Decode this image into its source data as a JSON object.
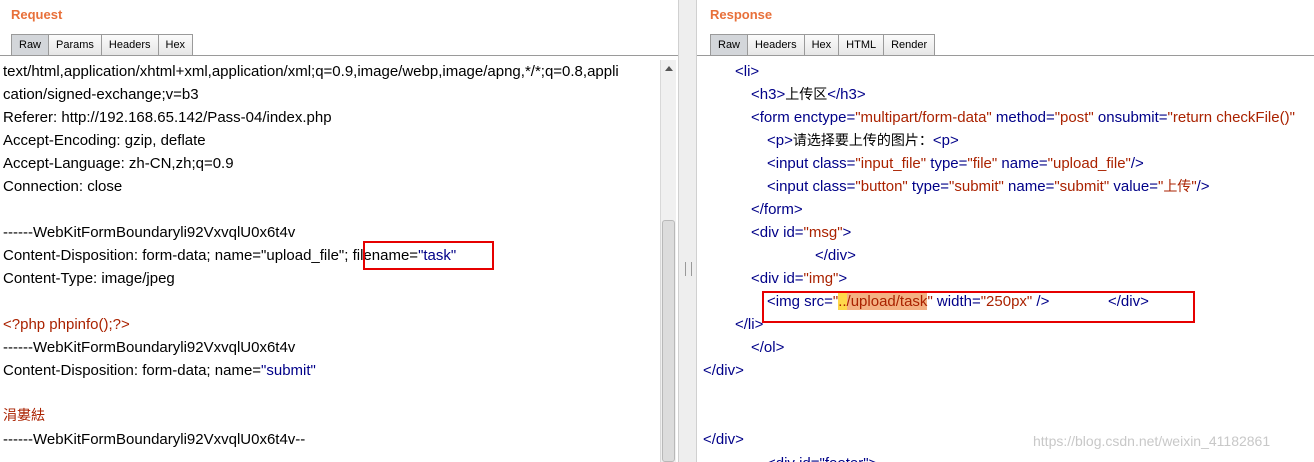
{
  "request": {
    "title": "Request",
    "tabs": [
      "Raw",
      "Params",
      "Headers",
      "Hex"
    ],
    "active_tab": "Raw",
    "lines": {
      "l0": "text/html,application/xhtml+xml,application/xml;q=0.9,image/webp,image/apng,*/*;q=0.8,appli",
      "l1": "cation/signed-exchange;v=b3",
      "l2": "Referer: http://192.168.65.142/Pass-04/index.php",
      "l3": "Accept-Encoding: gzip, deflate",
      "l4": "Accept-Language: zh-CN,zh;q=0.9",
      "l5": "Connection: close",
      "l7": "------WebKitFormBoundaryli92VxvqlU0x6t4v",
      "l8_prefix": "Content-Disposition: form-data; name=\"upload_file\"; ",
      "l8_filename_key": "filename=",
      "l8_filename_val": "\"task\"",
      "l9": "Content-Type: image/jpeg",
      "l11": "<?php phpinfo();?>",
      "l12": "------WebKitFormBoundaryli92VxvqlU0x6t4v",
      "l13_prefix": "Content-Disposition: form-data; name=",
      "l13_val": "\"submit\"",
      "l15": "涓婁紶",
      "l16": "------WebKitFormBoundaryli92VxvqlU0x6t4v--"
    }
  },
  "response": {
    "title": "Response",
    "tabs": [
      "Raw",
      "Headers",
      "Hex",
      "HTML",
      "Render"
    ],
    "active_tab": "Raw",
    "lines": {
      "li_open": "<li>",
      "h3_open": "<h3>",
      "h3_text": "上传区",
      "h3_close": "</h3>",
      "form_open": "<form",
      "form_attr1": " enctype=",
      "form_val1": "\"multipart/form-data\"",
      "form_attr2": " method=",
      "form_val2": "\"post\"",
      "form_attr3": " onsubmit=",
      "form_val3": "\"return checkFile()\"",
      "p_open": "<p>",
      "p_text": "请选择要上传的图片：",
      "p_close": "<p>",
      "input1_open": "<input",
      "input1_a1": " class=",
      "input1_v1": "\"input_file\"",
      "input1_a2": " type=",
      "input1_v2": "\"file\"",
      "input1_a3": " name=",
      "input1_v3": "\"upload_file\"",
      "input1_close": "/>",
      "input2_open": "<input",
      "input2_a1": " class=",
      "input2_v1": "\"button\"",
      "input2_a2": " type=",
      "input2_v2": "\"submit\"",
      "input2_a3": " name=",
      "input2_v3": "\"submit\"",
      "input2_a4": " value=",
      "input2_v4_q1": "\"",
      "input2_v4": "上传",
      "input2_v4_q2": "\"",
      "input2_close": "/>",
      "form_close": "</form>",
      "div_msg_open": "<div",
      "div_msg_attr": " id=",
      "div_msg_val": "\"msg\"",
      "div_msg_gt": ">",
      "div_msg_close": "</div>",
      "div_img_open": "<div",
      "div_img_attr": " id=",
      "div_img_val": "\"img\"",
      "div_img_gt": ">",
      "img_open": "<img",
      "img_a1": " src=",
      "img_q1": "\"",
      "img_src_dots": "..",
      "img_src_path": "/upload/task",
      "img_q2": "\"",
      "img_a2": " width=",
      "img_v2": "\"250px\"",
      "img_close": " />",
      "img_div_close": "</div>",
      "li_close": "</li>",
      "ol_close": "</ol>",
      "div_close1": "</div>",
      "div_close2": "</div>",
      "footer_partial": "<div id=\"footer\">"
    }
  },
  "watermark": "https://blog.csdn.net/weixin_41182861",
  "colors": {
    "title_orange": "#e8703a",
    "tag_blue": "#000088",
    "value_red": "#aa2200",
    "highlight_box": "#e60000",
    "highlight_yellow": "#ffd84a",
    "highlight_orange": "#f4b183"
  }
}
